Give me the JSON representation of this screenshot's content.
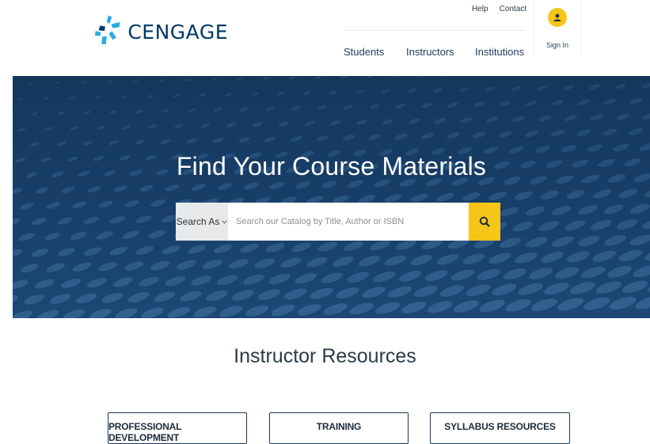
{
  "brand": {
    "name": "CENGAGE",
    "logo_icon": "cengage-pinwheel-icon",
    "colors": {
      "navy": "#003865",
      "accent_yellow": "#F5C518",
      "hero_blue": "#173D66",
      "logo_teal": "#29ABE2"
    }
  },
  "utility_nav": {
    "help": "Help",
    "contact": "Contact"
  },
  "main_nav": {
    "students": "Students",
    "instructors": "Instructors",
    "institutions": "Institutions"
  },
  "account": {
    "sign_in": "Sign In",
    "icon": "user-icon"
  },
  "hero": {
    "title": "Find Your Course Materials",
    "search": {
      "search_as_label": "Search As",
      "search_as_icon": "chevron-down-icon",
      "placeholder": "Search our Catalog by Title, Author or ISBN",
      "value": "",
      "button_icon": "search-icon"
    }
  },
  "resources": {
    "title": "Instructor Resources",
    "buttons": [
      {
        "label": "PROFESSIONAL DEVELOPMENT"
      },
      {
        "label": "TRAINING"
      },
      {
        "label": "SYLLABUS RESOURCES"
      }
    ]
  }
}
